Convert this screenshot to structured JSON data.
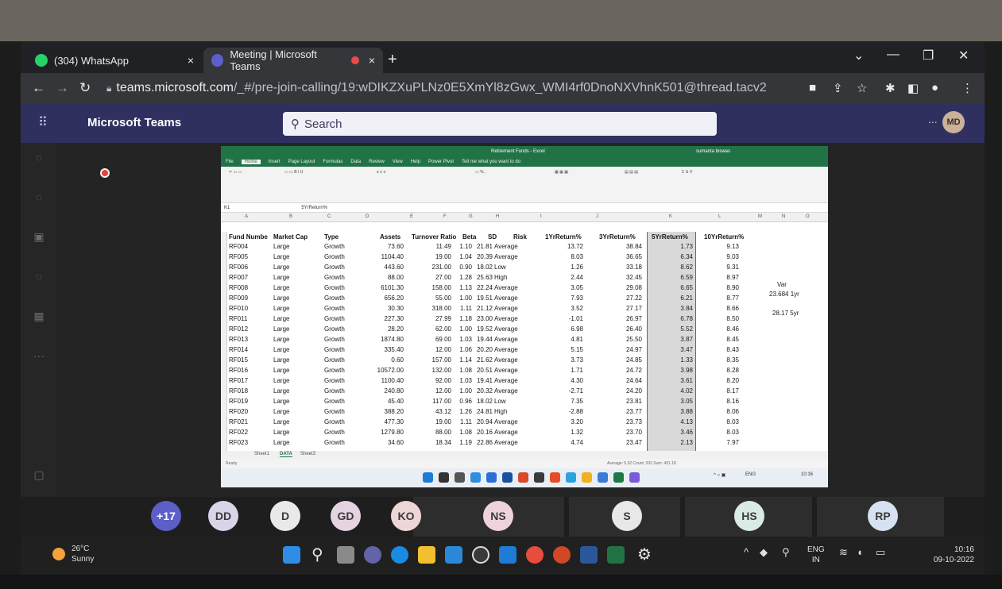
{
  "browser": {
    "tabs": [
      {
        "label": "(304) WhatsApp",
        "close": "×"
      },
      {
        "label": "Meeting | Microsoft Teams",
        "close": "×"
      }
    ],
    "new_tab": "+",
    "url_host": "teams.microsoft.com",
    "url_path": "/_#/pre-join-calling/19:wDIKZXuPLNz0E5XmYl8zGwx_WMI4rf0DnoNXVhnK501@thread.tacv2"
  },
  "teams": {
    "app_name": "Microsoft Teams",
    "search_placeholder": "Search",
    "user_initials": "MD",
    "more": "..."
  },
  "excel": {
    "window_title": "Retirement Funds - Excel",
    "user_name": "sumanta biswas",
    "ribbon_tabs": [
      "File",
      "Home",
      "Insert",
      "Page Layout",
      "Formulas",
      "Data",
      "Review",
      "View",
      "Help",
      "Power Pivot",
      "Tell me what you want to do"
    ],
    "name_box": "K1",
    "formula": "5YrReturn%",
    "columns": [
      "A",
      "B",
      "C",
      "D",
      "E",
      "F",
      "G",
      "H",
      "I",
      "J",
      "K",
      "L",
      "M",
      "N",
      "O"
    ],
    "headers": [
      "Fund Numbe",
      "Market Cap",
      "Type",
      "Assets",
      "Turnover Ratio",
      "Beta",
      "SD",
      "Risk",
      "1YrReturn%",
      "3YrReturn%",
      "5YrReturn%",
      "10YrReturn%"
    ],
    "rows": [
      [
        "RF004",
        "Large",
        "Growth",
        "73.60",
        "11.49",
        "1.10",
        "21.81",
        "Average",
        "13.72",
        "38.84",
        "1.73",
        "9.13"
      ],
      [
        "RF005",
        "Large",
        "Growth",
        "1104.40",
        "19.00",
        "1.04",
        "20.39",
        "Average",
        "8.03",
        "36.65",
        "6.34",
        "9.03"
      ],
      [
        "RF006",
        "Large",
        "Growth",
        "443.60",
        "231.00",
        "0.90",
        "18.02",
        "Low",
        "1.26",
        "33.18",
        "8.62",
        "9.31"
      ],
      [
        "RF007",
        "Large",
        "Growth",
        "88.00",
        "27.00",
        "1.28",
        "25.63",
        "High",
        "2.44",
        "32.45",
        "6.59",
        "8.97"
      ],
      [
        "RF008",
        "Large",
        "Growth",
        "6101.30",
        "158.00",
        "1.13",
        "22.24",
        "Average",
        "3.05",
        "29.08",
        "6.65",
        "8.90"
      ],
      [
        "RF009",
        "Large",
        "Growth",
        "656.20",
        "55.00",
        "1.00",
        "19.51",
        "Average",
        "7.93",
        "27.22",
        "6.21",
        "8.77"
      ],
      [
        "RF010",
        "Large",
        "Growth",
        "30.30",
        "318.00",
        "1.11",
        "21.12",
        "Average",
        "3.52",
        "27.17",
        "3.84",
        "8.66"
      ],
      [
        "RF011",
        "Large",
        "Growth",
        "227.30",
        "27.99",
        "1.18",
        "23.00",
        "Average",
        "-1.01",
        "26.97",
        "6.78",
        "8.50"
      ],
      [
        "RF012",
        "Large",
        "Growth",
        "28.20",
        "62.00",
        "1.00",
        "19.52",
        "Average",
        "6.98",
        "26.40",
        "5.52",
        "8.46"
      ],
      [
        "RF013",
        "Large",
        "Growth",
        "1874.80",
        "69.00",
        "1.03",
        "19.44",
        "Average",
        "4.81",
        "25.50",
        "3.87",
        "8.45"
      ],
      [
        "RF014",
        "Large",
        "Growth",
        "335.40",
        "12.00",
        "1.06",
        "20.20",
        "Average",
        "5.15",
        "24.97",
        "3.47",
        "8.43"
      ],
      [
        "RF015",
        "Large",
        "Growth",
        "0.60",
        "157.00",
        "1.14",
        "21.62",
        "Average",
        "3.73",
        "24.85",
        "1.33",
        "8.35"
      ],
      [
        "RF016",
        "Large",
        "Growth",
        "10572.00",
        "132.00",
        "1.08",
        "20.51",
        "Average",
        "1.71",
        "24.72",
        "3.98",
        "8.28"
      ],
      [
        "RF017",
        "Large",
        "Growth",
        "1100.40",
        "92.00",
        "1.03",
        "19.41",
        "Average",
        "4.30",
        "24.64",
        "3.61",
        "8.20"
      ],
      [
        "RF018",
        "Large",
        "Growth",
        "240.80",
        "12.00",
        "1.00",
        "20.32",
        "Average",
        "-2.71",
        "24.20",
        "4.02",
        "8.17"
      ],
      [
        "RF019",
        "Large",
        "Growth",
        "45.40",
        "117.00",
        "0.96",
        "18.02",
        "Low",
        "7.35",
        "23.81",
        "3.05",
        "8.16"
      ],
      [
        "RF020",
        "Large",
        "Growth",
        "388.20",
        "43.12",
        "1.26",
        "24.81",
        "High",
        "-2.88",
        "23.77",
        "3.88",
        "8.06"
      ],
      [
        "RF021",
        "Large",
        "Growth",
        "477.30",
        "19.00",
        "1.11",
        "20.94",
        "Average",
        "3.20",
        "23.73",
        "4.13",
        "8.03"
      ],
      [
        "RF022",
        "Large",
        "Growth",
        "1279.80",
        "88.00",
        "1.08",
        "20.16",
        "Average",
        "1.32",
        "23.70",
        "3.46",
        "8.03"
      ],
      [
        "RF023",
        "Large",
        "Growth",
        "34.60",
        "18.34",
        "1.19",
        "22.86",
        "Average",
        "4.74",
        "23.47",
        "2.13",
        "7.97"
      ]
    ],
    "notes": {
      "var_label": "Var",
      "var_1yr": "23.684 1yr",
      "var_5yr": "28.17 5yr"
    },
    "sheet_tabs": [
      "Sheet1",
      "DATA",
      "Sheet3"
    ],
    "status_left": "Ready",
    "status_mid": "Average: 5.32    Count: 202    Sum: 491.18"
  },
  "participants": [
    "+17",
    "DD",
    "D",
    "GD",
    "KO",
    "NS",
    "S",
    "HS",
    "RP"
  ],
  "windows": {
    "weather_temp": "26°C",
    "weather_desc": "Sunny",
    "lang_1": "ENG",
    "lang_2": "IN",
    "time": "10:16",
    "date": "09-10-2022"
  },
  "colors": {
    "teams_header": "#2f3060",
    "excel_green": "#217346",
    "record_red": "#e8403c"
  }
}
